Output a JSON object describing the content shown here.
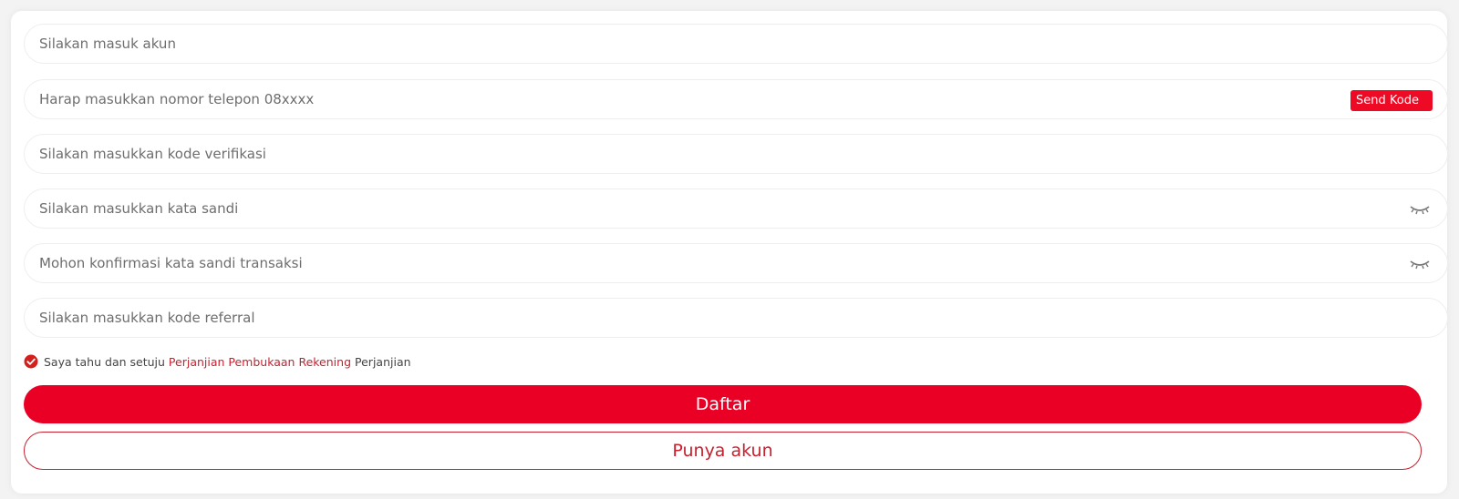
{
  "form": {
    "fields": [
      {
        "placeholder": "Silakan masuk akun",
        "value": ""
      },
      {
        "placeholder": "Harap masukkan nomor telepon 08xxxx",
        "value": ""
      },
      {
        "placeholder": "Silakan masukkan kode verifikasi",
        "value": ""
      },
      {
        "placeholder": "Silakan masukkan kata sandi",
        "value": ""
      },
      {
        "placeholder": "Mohon konfirmasi kata sandi transaksi",
        "value": ""
      },
      {
        "placeholder": "Silakan masukkan kode referral",
        "value": ""
      }
    ],
    "send_code_label": "Send Kode",
    "password_toggle_icon": "eye-closed-icon"
  },
  "agreement": {
    "checked": true,
    "check_icon": "check-circle-icon",
    "prefix": "Saya tahu dan setuju",
    "link_text": "Perjanjian Pembukaan Rekening",
    "suffix": "Perjanjian"
  },
  "buttons": {
    "register_label": "Daftar",
    "login_label": "Punya akun"
  },
  "colors": {
    "accent": "#e90024",
    "link": "#c8202f",
    "field_border": "#eeeeee"
  }
}
